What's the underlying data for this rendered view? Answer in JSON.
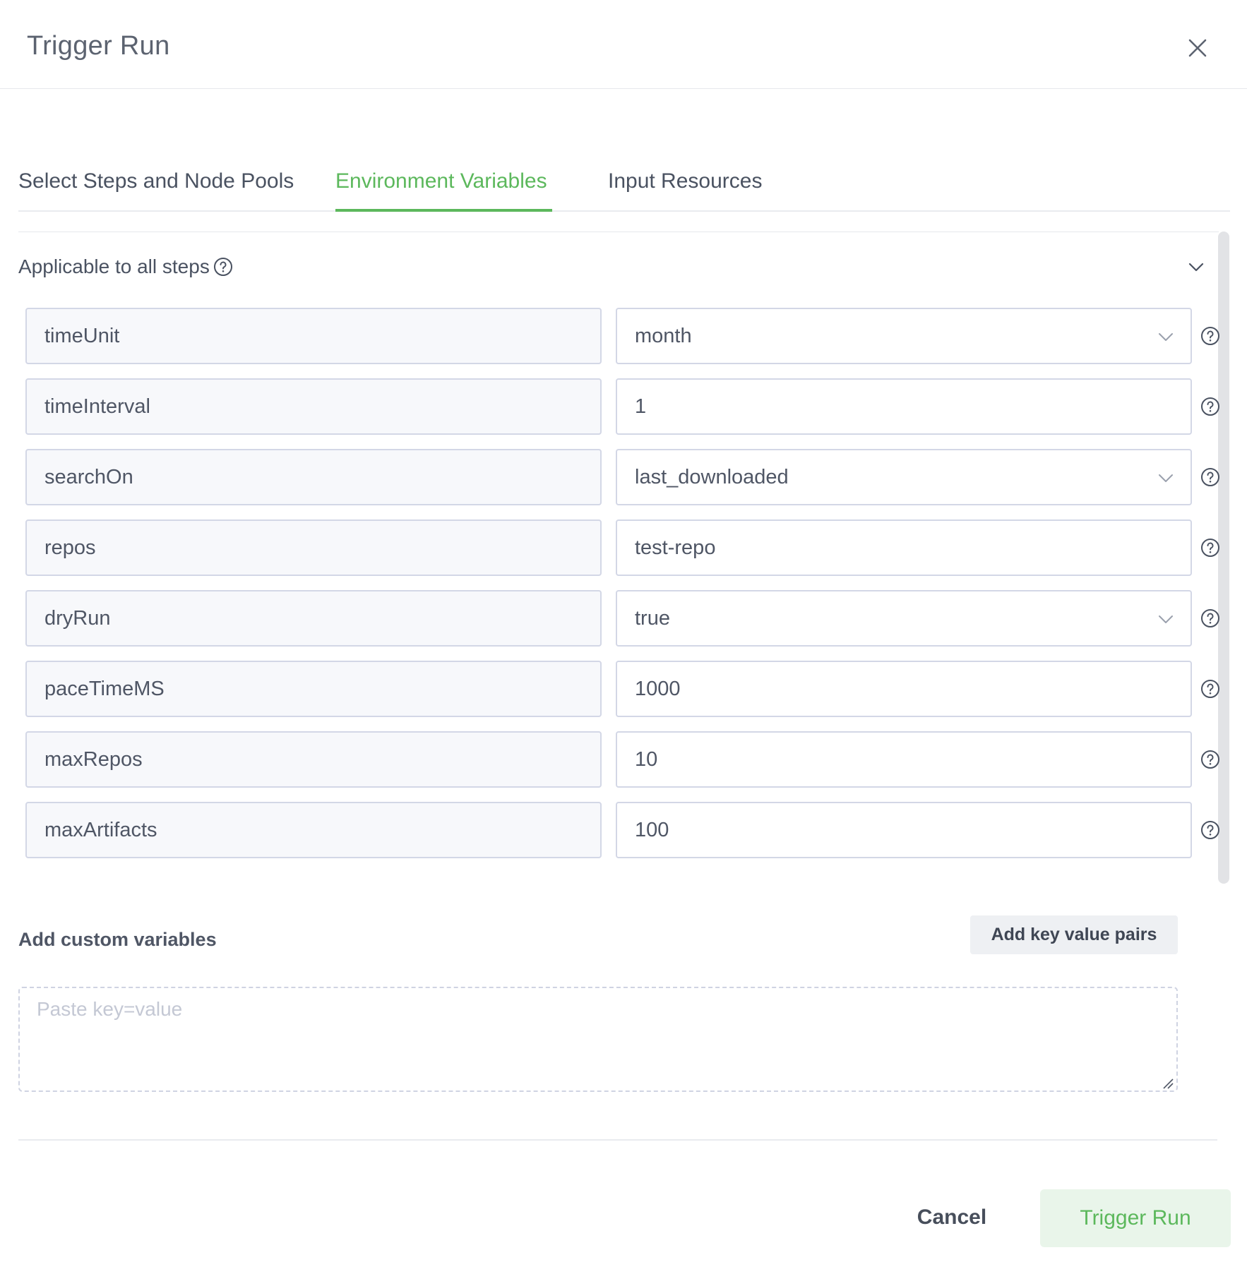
{
  "dialog": {
    "title": "Trigger Run"
  },
  "tabs": [
    {
      "label": "Select Steps and Node Pools",
      "active": false
    },
    {
      "label": "Environment Variables",
      "active": true
    },
    {
      "label": "Input Resources",
      "active": false
    }
  ],
  "section": {
    "title": "Applicable to all steps"
  },
  "variables": [
    {
      "key": "timeUnit",
      "value": "month",
      "type": "select"
    },
    {
      "key": "timeInterval",
      "value": "1",
      "type": "text"
    },
    {
      "key": "searchOn",
      "value": "last_downloaded",
      "type": "select"
    },
    {
      "key": "repos",
      "value": "test-repo",
      "type": "text"
    },
    {
      "key": "dryRun",
      "value": "true",
      "type": "select"
    },
    {
      "key": "paceTimeMS",
      "value": "1000",
      "type": "text"
    },
    {
      "key": "maxRepos",
      "value": "10",
      "type": "text"
    },
    {
      "key": "maxArtifacts",
      "value": "100",
      "type": "text"
    }
  ],
  "custom": {
    "label": "Add custom variables",
    "add_button": "Add key value pairs",
    "placeholder": "Paste key=value"
  },
  "footer": {
    "cancel": "Cancel",
    "trigger": "Trigger Run"
  },
  "colors": {
    "accent": "#5cb85c",
    "accent_bg": "#e9f5ea",
    "border": "#d3d7e6"
  }
}
